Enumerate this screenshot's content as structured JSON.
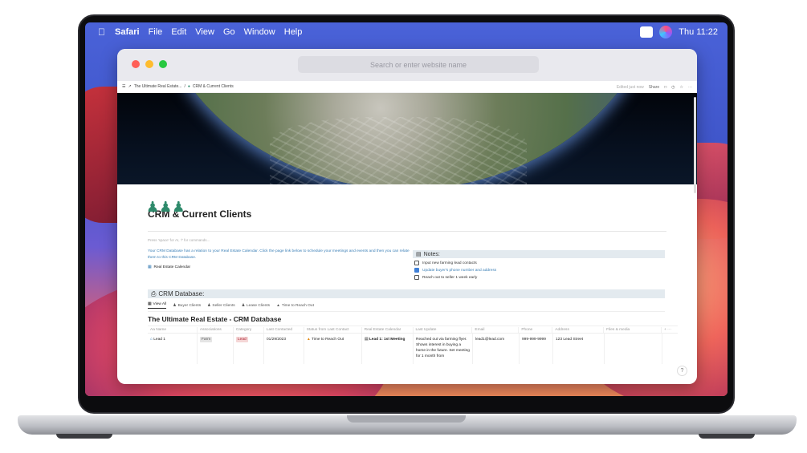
{
  "menubar": {
    "apple": "",
    "app": "Safari",
    "items": [
      "File",
      "Edit",
      "View",
      "Go",
      "Window",
      "Help"
    ],
    "clock": "Thu 11:22"
  },
  "browser": {
    "url_placeholder": "Search or enter website name",
    "breadcrumb_parent": "The Ultimate Real Estate...",
    "breadcrumb_sep": "/",
    "breadcrumb_current": "CRM & Current Clients",
    "edited": "Edited just now",
    "share": "Share"
  },
  "page": {
    "title": "CRM & Current Clients",
    "hint": "Press 'space' for AI, '/' for commands...",
    "description": "Your CRM Database has a relation to your Real Estate Calendar. Click the page link below to schedule your meetings and events and then you can relate them to this CRM Database.",
    "calendar_link": "Real Estate Calendar",
    "notes_heading": "Notes:",
    "todos": [
      {
        "text": "Input new farming lead contacts",
        "checked": false
      },
      {
        "text": "Update buyer's phone number and address",
        "checked": true
      },
      {
        "text": "Reach out to seller 1 week early",
        "checked": false
      }
    ],
    "db_heading": "CRM Database:",
    "views": [
      "View All",
      "Buyer Clients",
      "Seller Clients",
      "Lease Clients",
      "Time to Reach Out"
    ],
    "db_title": "The Ultimate Real Estate - CRM Database",
    "columns": [
      "Aa Name",
      "Associations",
      "Category",
      "Last Contacted",
      "Status from Last Contact",
      "Real Estate Calendar",
      "Last Update",
      "Email",
      "Phone",
      "Address",
      "Files & media"
    ],
    "row": {
      "name": "Lead 1",
      "association": "Farm",
      "category": "Lead",
      "last_contacted": "01/29/2023",
      "status": "Time to Reach Out",
      "calendar": "Lead 1: 1st Meeting",
      "last_update": "Reached out via farming flyer. Shows interest in buying a home in the future. Set meeting for 1 month from",
      "email": "lead1@lead.com",
      "phone": "999-999-9999",
      "address": "123 Lead Street",
      "files": ""
    },
    "help": "?"
  }
}
